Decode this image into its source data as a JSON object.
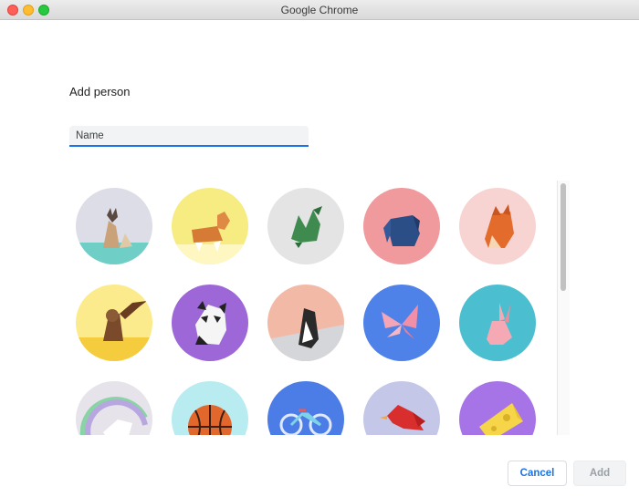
{
  "window": {
    "title": "Google Chrome"
  },
  "dialog": {
    "heading": "Add person",
    "name_field": {
      "placeholder": "Name",
      "value": ""
    },
    "avatars": [
      {
        "id": "cat-icon",
        "bg": "#dcdde7",
        "accent": "#6fcfc7"
      },
      {
        "id": "corgi-icon",
        "bg": "#f7ec82",
        "accent": "#ffffff"
      },
      {
        "id": "dragon-icon",
        "bg": "#e4e4e4",
        "accent": "#f1f1f1"
      },
      {
        "id": "elephant-icon",
        "bg": "#f09a9e",
        "accent": "#e47d82"
      },
      {
        "id": "fox-icon",
        "bg": "#f7d3d1",
        "accent": "#fbe6e4"
      },
      {
        "id": "monkey-icon",
        "bg": "#fbeb8c",
        "accent": "#f4cc3d"
      },
      {
        "id": "panda-icon",
        "bg": "#9d67d8",
        "accent": "#8b55c9"
      },
      {
        "id": "penguin-icon",
        "bg": "#f3b9a7",
        "accent": "#d5d6da"
      },
      {
        "id": "butterfly-icon",
        "bg": "#4f82e9",
        "accent": "#3b6cd2"
      },
      {
        "id": "rabbit-icon",
        "bg": "#4bbed0",
        "accent": "#3aaabd"
      },
      {
        "id": "unicorn-icon",
        "bg": "#e6e3ea",
        "accent": "#b8a6e0"
      },
      {
        "id": "basketball-icon",
        "bg": "#b9ecf0",
        "accent": "#a3e2e8"
      },
      {
        "id": "bicycle-icon",
        "bg": "#4c7ce6",
        "accent": "#3b67cc"
      },
      {
        "id": "bird-icon",
        "bg": "#c4c7e8",
        "accent": "#b6b9de"
      },
      {
        "id": "cheese-icon",
        "bg": "#a774e8",
        "accent": "#9460da"
      }
    ]
  },
  "buttons": {
    "cancel": "Cancel",
    "add": "Add"
  }
}
